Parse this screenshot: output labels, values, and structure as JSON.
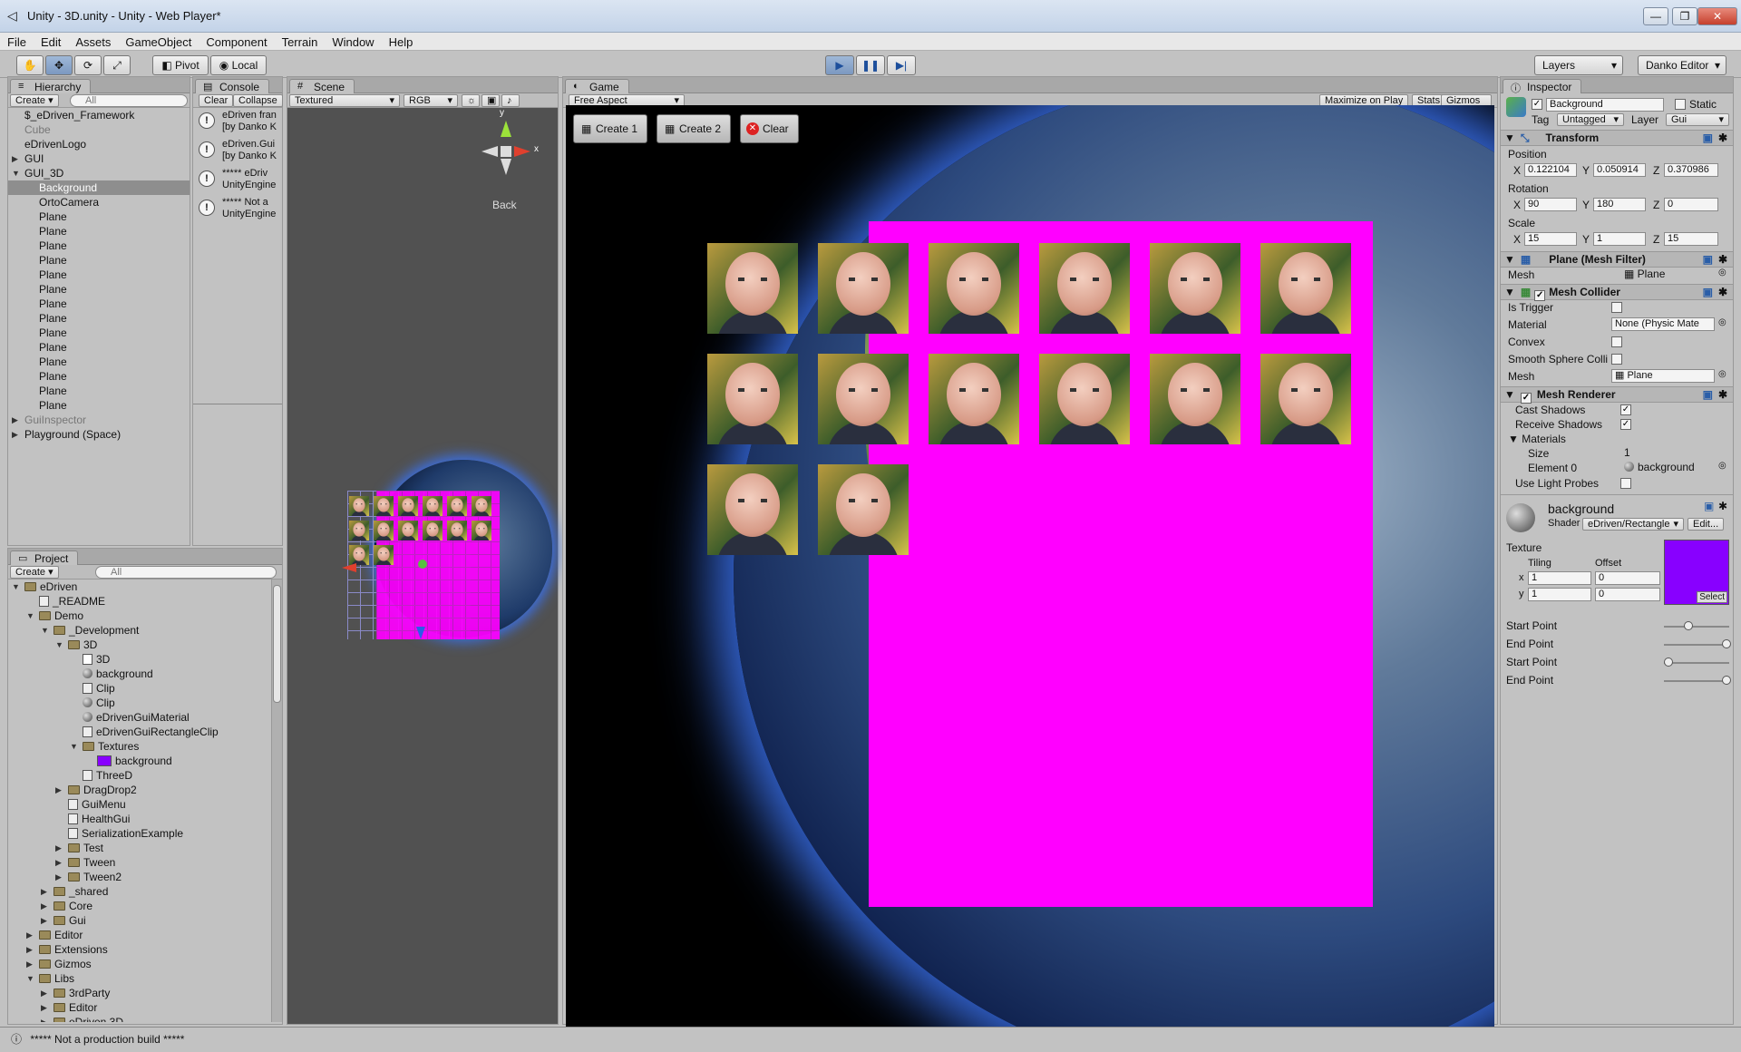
{
  "window": {
    "title": "Unity - 3D.unity - Unity - Web Player*",
    "controls": [
      "—",
      "❐",
      "✕"
    ]
  },
  "menu": [
    "File",
    "Edit",
    "Assets",
    "GameObject",
    "Component",
    "Terrain",
    "Window",
    "Help"
  ],
  "toolbar": {
    "pivot": "Pivot",
    "local": "Local",
    "layers": "Layers",
    "layout": "Danko Editor"
  },
  "hierarchy": {
    "tab": "Hierarchy",
    "create": "Create",
    "search": "All",
    "items": [
      {
        "label": "$_eDriven_Framework",
        "depth": 0,
        "arrow": "",
        "selected": false,
        "dim": false
      },
      {
        "label": "Cube",
        "depth": 0,
        "arrow": "",
        "selected": false,
        "dim": true
      },
      {
        "label": "eDrivenLogo",
        "depth": 0,
        "arrow": "",
        "selected": false,
        "dim": false
      },
      {
        "label": "GUI",
        "depth": 0,
        "arrow": "▶",
        "selected": false,
        "dim": false
      },
      {
        "label": "GUI_3D",
        "depth": 0,
        "arrow": "▼",
        "selected": false,
        "dim": false
      },
      {
        "label": "Background",
        "depth": 1,
        "arrow": "",
        "selected": true,
        "dim": false
      },
      {
        "label": "OrtoCamera",
        "depth": 1,
        "arrow": "",
        "selected": false,
        "dim": false
      },
      {
        "label": "Plane",
        "depth": 1,
        "arrow": "",
        "selected": false,
        "dim": false
      },
      {
        "label": "Plane",
        "depth": 1,
        "arrow": "",
        "selected": false,
        "dim": false
      },
      {
        "label": "Plane",
        "depth": 1,
        "arrow": "",
        "selected": false,
        "dim": false
      },
      {
        "label": "Plane",
        "depth": 1,
        "arrow": "",
        "selected": false,
        "dim": false
      },
      {
        "label": "Plane",
        "depth": 1,
        "arrow": "",
        "selected": false,
        "dim": false
      },
      {
        "label": "Plane",
        "depth": 1,
        "arrow": "",
        "selected": false,
        "dim": false
      },
      {
        "label": "Plane",
        "depth": 1,
        "arrow": "",
        "selected": false,
        "dim": false
      },
      {
        "label": "Plane",
        "depth": 1,
        "arrow": "",
        "selected": false,
        "dim": false
      },
      {
        "label": "Plane",
        "depth": 1,
        "arrow": "",
        "selected": false,
        "dim": false
      },
      {
        "label": "Plane",
        "depth": 1,
        "arrow": "",
        "selected": false,
        "dim": false
      },
      {
        "label": "Plane",
        "depth": 1,
        "arrow": "",
        "selected": false,
        "dim": false
      },
      {
        "label": "Plane",
        "depth": 1,
        "arrow": "",
        "selected": false,
        "dim": false
      },
      {
        "label": "Plane",
        "depth": 1,
        "arrow": "",
        "selected": false,
        "dim": false
      },
      {
        "label": "Plane",
        "depth": 1,
        "arrow": "",
        "selected": false,
        "dim": false
      },
      {
        "label": "GuiInspector",
        "depth": 0,
        "arrow": "▶",
        "selected": false,
        "dim": true
      },
      {
        "label": "Playground (Space)",
        "depth": 0,
        "arrow": "▶",
        "selected": false,
        "dim": false
      }
    ]
  },
  "console": {
    "tab": "Console",
    "clear": "Clear",
    "collapse": "Collapse",
    "entries": [
      {
        "line1": "eDriven fran",
        "line2": "[by Danko K"
      },
      {
        "line1": "eDriven.Gui",
        "line2": "[by Danko K"
      },
      {
        "line1": "***** eDriv",
        "line2": "UnityEngine"
      },
      {
        "line1": "***** Not a",
        "line2": "UnityEngine"
      }
    ]
  },
  "scene": {
    "tab": "Scene",
    "render_mode": "Textured",
    "channel": "RGB",
    "gizmo_label": "Back",
    "gizmo_y": "y",
    "gizmo_x": "x"
  },
  "game": {
    "tab": "Game",
    "aspect": "Free Aspect",
    "maximize": "Maximize on Play",
    "stats": "Stats",
    "gizmos": "Gizmos",
    "buttons": [
      "Create 1",
      "Create 2",
      "Clear"
    ],
    "faces_row1": 6,
    "faces_row2": 6,
    "faces_row3": 2
  },
  "project": {
    "tab": "Project",
    "create": "Create",
    "search": "All",
    "items": [
      {
        "label": "eDriven",
        "depth": 0,
        "arrow": "▼",
        "type": "folder"
      },
      {
        "label": "_README",
        "depth": 1,
        "arrow": "",
        "type": "file"
      },
      {
        "label": "Demo",
        "depth": 1,
        "arrow": "▼",
        "type": "folder"
      },
      {
        "label": "_Development",
        "depth": 2,
        "arrow": "▼",
        "type": "folder"
      },
      {
        "label": "3D",
        "depth": 3,
        "arrow": "▼",
        "type": "folder"
      },
      {
        "label": "3D",
        "depth": 4,
        "arrow": "",
        "type": "unity"
      },
      {
        "label": "background",
        "depth": 4,
        "arrow": "",
        "type": "sphere"
      },
      {
        "label": "Clip",
        "depth": 4,
        "arrow": "",
        "type": "file"
      },
      {
        "label": "Clip",
        "depth": 4,
        "arrow": "",
        "type": "sphere"
      },
      {
        "label": "eDrivenGuiMaterial",
        "depth": 4,
        "arrow": "",
        "type": "sphere"
      },
      {
        "label": "eDrivenGuiRectangleClip",
        "depth": 4,
        "arrow": "",
        "type": "file"
      },
      {
        "label": "Textures",
        "depth": 4,
        "arrow": "▼",
        "type": "folder"
      },
      {
        "label": "background",
        "depth": 5,
        "arrow": "",
        "type": "purple"
      },
      {
        "label": "ThreeD",
        "depth": 4,
        "arrow": "",
        "type": "file"
      },
      {
        "label": "DragDrop2",
        "depth": 3,
        "arrow": "▶",
        "type": "folder"
      },
      {
        "label": "GuiMenu",
        "depth": 3,
        "arrow": "",
        "type": "file"
      },
      {
        "label": "HealthGui",
        "depth": 3,
        "arrow": "",
        "type": "file"
      },
      {
        "label": "SerializationExample",
        "depth": 3,
        "arrow": "",
        "type": "file"
      },
      {
        "label": "Test",
        "depth": 3,
        "arrow": "▶",
        "type": "folder"
      },
      {
        "label": "Tween",
        "depth": 3,
        "arrow": "▶",
        "type": "folder"
      },
      {
        "label": "Tween2",
        "depth": 3,
        "arrow": "▶",
        "type": "folder"
      },
      {
        "label": "_shared",
        "depth": 2,
        "arrow": "▶",
        "type": "folder"
      },
      {
        "label": "Core",
        "depth": 2,
        "arrow": "▶",
        "type": "folder"
      },
      {
        "label": "Gui",
        "depth": 2,
        "arrow": "▶",
        "type": "folder"
      },
      {
        "label": "Editor",
        "depth": 1,
        "arrow": "▶",
        "type": "folder"
      },
      {
        "label": "Extensions",
        "depth": 1,
        "arrow": "▶",
        "type": "folder"
      },
      {
        "label": "Gizmos",
        "depth": 1,
        "arrow": "▶",
        "type": "folder"
      },
      {
        "label": "Libs",
        "depth": 1,
        "arrow": "▼",
        "type": "folder"
      },
      {
        "label": "3rdParty",
        "depth": 2,
        "arrow": "▶",
        "type": "folder"
      },
      {
        "label": "Editor",
        "depth": 2,
        "arrow": "▶",
        "type": "folder"
      },
      {
        "label": "eDriven.3D",
        "depth": 2,
        "arrow": "▶",
        "type": "folder"
      }
    ]
  },
  "inspector": {
    "tab": "Inspector",
    "object_name": "Background",
    "static": "Static",
    "tag_label": "Tag",
    "tag": "Untagged",
    "layer_label": "Layer",
    "layer": "Gui",
    "transform": {
      "title": "Transform",
      "position": "Position",
      "rotation": "Rotation",
      "scale": "Scale",
      "pos": [
        "0.122104",
        "0.050914",
        "0.370986"
      ],
      "rot": [
        "90",
        "180",
        "0"
      ],
      "scl": [
        "15",
        "1",
        "15"
      ]
    },
    "meshfilter": {
      "title": "Plane (Mesh Filter)",
      "mesh_label": "Mesh",
      "mesh": "Plane"
    },
    "collider": {
      "title": "Mesh Collider",
      "is_trigger": "Is Trigger",
      "material_label": "Material",
      "material": "None (Physic Mate",
      "convex": "Convex",
      "smooth": "Smooth Sphere Colli",
      "mesh_label": "Mesh",
      "mesh": "Plane"
    },
    "renderer": {
      "title": "Mesh Renderer",
      "cast": "Cast Shadows",
      "receive": "Receive Shadows",
      "materials": "Materials",
      "size_label": "Size",
      "size": "1",
      "element_label": "Element 0",
      "element": "background",
      "light_probes": "Use Light Probes"
    },
    "material": {
      "name": "background",
      "shader_label": "Shader",
      "shader": "eDriven/Rectangle",
      "edit": "Edit...",
      "texture": "Texture",
      "tiling": "Tiling",
      "offset": "Offset",
      "x": "x",
      "y": "y",
      "tx": "1",
      "ty": "1",
      "ox": "0",
      "oy": "0",
      "select": "Select",
      "tex_color": "#8800ff"
    },
    "sliders": [
      {
        "label": "Start Point",
        "value": 0.35
      },
      {
        "label": "End Point",
        "value": 1.0
      },
      {
        "label": "Start Point",
        "value": 0.0
      },
      {
        "label": "End Point",
        "value": 1.0
      }
    ]
  },
  "status": "***** Not a production build *****",
  "colors": {
    "magenta": "#ff00ff",
    "play_blue": "#3a78c8"
  }
}
